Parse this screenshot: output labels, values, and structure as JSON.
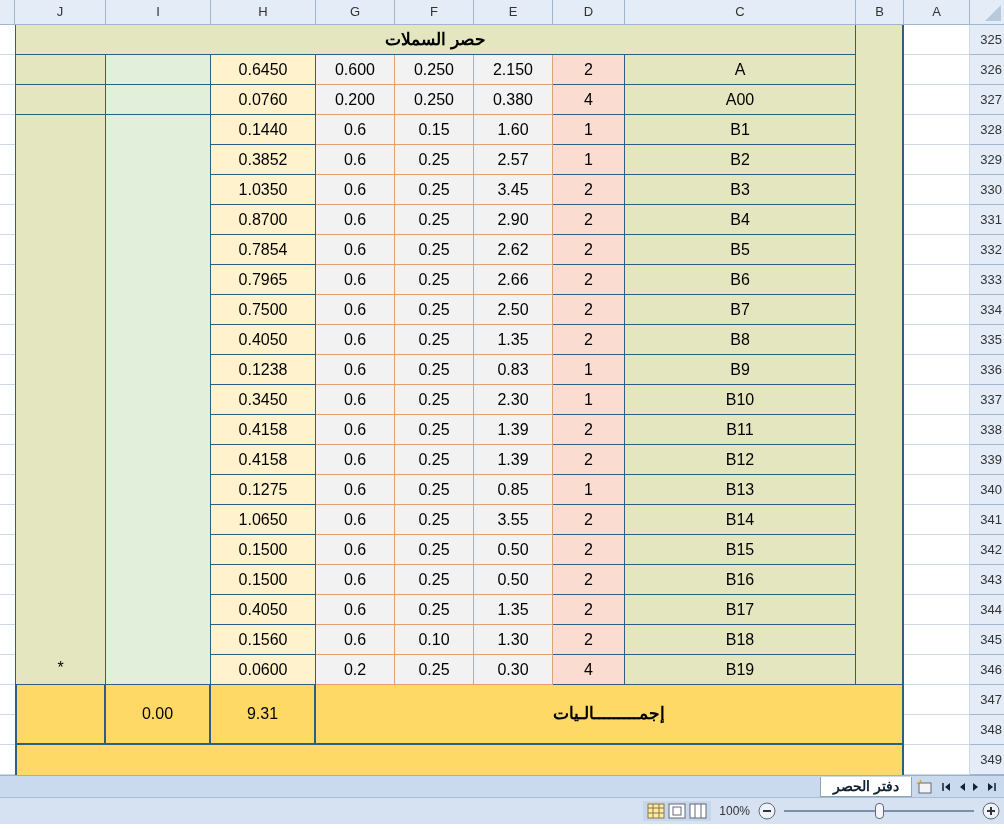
{
  "column_headers": [
    "J",
    "I",
    "H",
    "G",
    "F",
    "E",
    "D",
    "C",
    "B",
    "A"
  ],
  "row_numbers": [
    "325",
    "326",
    "327",
    "328",
    "329",
    "330",
    "331",
    "332",
    "333",
    "334",
    "335",
    "336",
    "337",
    "338",
    "339",
    "340",
    "341",
    "342",
    "343",
    "344",
    "345",
    "346",
    "347",
    "348",
    "349"
  ],
  "title": "حصر السملات",
  "rows": [
    {
      "c": "A",
      "d": "2",
      "e": "2.150",
      "f": "0.250",
      "g": "0.600",
      "h": "0.6450"
    },
    {
      "c": "A00",
      "d": "4",
      "e": "0.380",
      "f": "0.250",
      "g": "0.200",
      "h": "0.0760"
    },
    {
      "c": "B1",
      "d": "1",
      "e": "1.60",
      "f": "0.15",
      "g": "0.6",
      "h": "0.1440"
    },
    {
      "c": "B2",
      "d": "1",
      "e": "2.57",
      "f": "0.25",
      "g": "0.6",
      "h": "0.3852"
    },
    {
      "c": "B3",
      "d": "2",
      "e": "3.45",
      "f": "0.25",
      "g": "0.6",
      "h": "1.0350"
    },
    {
      "c": "B4",
      "d": "2",
      "e": "2.90",
      "f": "0.25",
      "g": "0.6",
      "h": "0.8700"
    },
    {
      "c": "B5",
      "d": "2",
      "e": "2.62",
      "f": "0.25",
      "g": "0.6",
      "h": "0.7854"
    },
    {
      "c": "B6",
      "d": "2",
      "e": "2.66",
      "f": "0.25",
      "g": "0.6",
      "h": "0.7965"
    },
    {
      "c": "B7",
      "d": "2",
      "e": "2.50",
      "f": "0.25",
      "g": "0.6",
      "h": "0.7500"
    },
    {
      "c": "B8",
      "d": "2",
      "e": "1.35",
      "f": "0.25",
      "g": "0.6",
      "h": "0.4050"
    },
    {
      "c": "B9",
      "d": "1",
      "e": "0.83",
      "f": "0.25",
      "g": "0.6",
      "h": "0.1238"
    },
    {
      "c": "B10",
      "d": "1",
      "e": "2.30",
      "f": "0.25",
      "g": "0.6",
      "h": "0.3450"
    },
    {
      "c": "B11",
      "d": "2",
      "e": "1.39",
      "f": "0.25",
      "g": "0.6",
      "h": "0.4158"
    },
    {
      "c": "B12",
      "d": "2",
      "e": "1.39",
      "f": "0.25",
      "g": "0.6",
      "h": "0.4158"
    },
    {
      "c": "B13",
      "d": "1",
      "e": "0.85",
      "f": "0.25",
      "g": "0.6",
      "h": "0.1275"
    },
    {
      "c": "B14",
      "d": "2",
      "e": "3.55",
      "f": "0.25",
      "g": "0.6",
      "h": "1.0650"
    },
    {
      "c": "B15",
      "d": "2",
      "e": "0.50",
      "f": "0.25",
      "g": "0.6",
      "h": "0.1500"
    },
    {
      "c": "B16",
      "d": "2",
      "e": "0.50",
      "f": "0.25",
      "g": "0.6",
      "h": "0.1500"
    },
    {
      "c": "B17",
      "d": "2",
      "e": "1.35",
      "f": "0.25",
      "g": "0.6",
      "h": "0.4050"
    },
    {
      "c": "B18",
      "d": "2",
      "e": "1.30",
      "f": "0.10",
      "g": "0.6",
      "h": "0.1560"
    },
    {
      "c": "B19",
      "d": "4",
      "e": "0.30",
      "f": "0.25",
      "g": "0.2",
      "h": "0.0600"
    }
  ],
  "side_note": "*",
  "totals": {
    "label": "إجمـــــــــالـيات",
    "h": "9.31",
    "i": "0.00"
  },
  "sheet_tabs": [
    {
      "label": "دفتر الحصر",
      "selected": true
    }
  ],
  "status_bar": {
    "zoom": "100%",
    "level": 0.5
  }
}
